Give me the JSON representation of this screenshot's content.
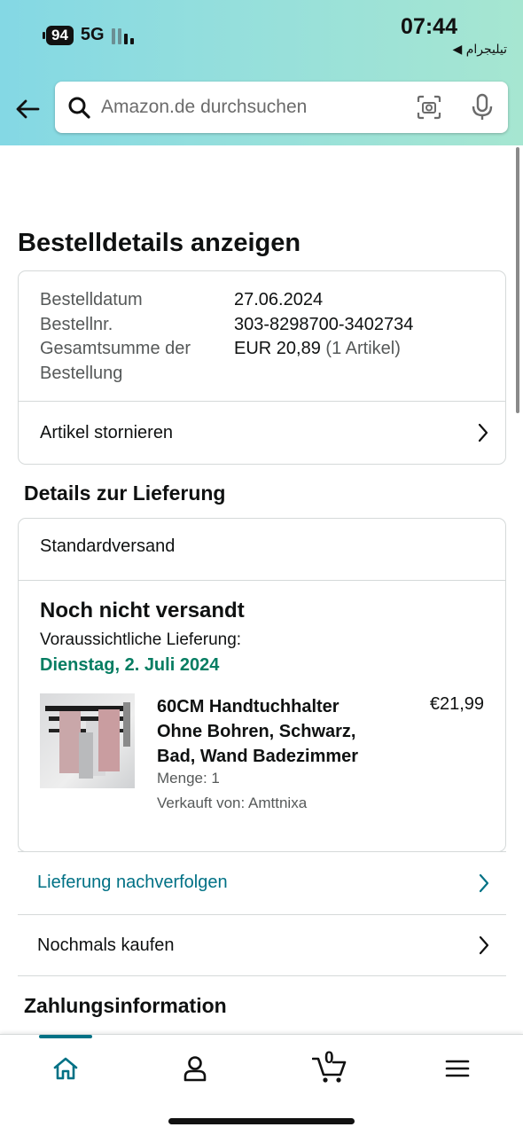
{
  "status_bar": {
    "battery": "94",
    "network": "5G",
    "time": "07:44",
    "back_app": "◀ تیلیجرام"
  },
  "search": {
    "placeholder": "Amazon.de durchsuchen"
  },
  "page": {
    "title": "Bestelldetails anzeigen"
  },
  "order_summary": {
    "date_label": "Bestelldatum",
    "date_value": "27.06.2024",
    "number_label": "Bestellnr.",
    "number_value": "303-8298700-3402734",
    "total_label_line1": "Gesamtsumme der",
    "total_label_line2": "Bestellung",
    "total_value": "EUR 20,89",
    "total_items": "(1 Artikel)",
    "cancel_label": "Artikel stornieren"
  },
  "delivery": {
    "heading": "Details zur Lieferung",
    "method": "Standardversand",
    "status": "Noch nicht versandt",
    "eta_label": "Voraussichtliche Lieferung:",
    "eta_date": "Dienstag, 2. Juli 2024",
    "product": {
      "title": "60CM Handtuchhalter Ohne Bohren, Schwarz, Bad, Wand Badezimmer",
      "price": "€21,99",
      "quantity": "Menge: 1",
      "seller": "Verkauft von: Amttnixa"
    },
    "track_label": "Lieferung nachverfolgen",
    "buy_again_label": "Nochmals kaufen"
  },
  "payment": {
    "heading": "Zahlungsinformation"
  },
  "tabbar": {
    "cart_count": "0",
    "active_tab": "home",
    "icons": [
      "home-icon",
      "account-icon",
      "cart-icon",
      "menu-icon"
    ]
  },
  "colors": {
    "link": "#007185",
    "eta_green": "#067d62",
    "text": "#0f1111",
    "muted": "#565959"
  }
}
